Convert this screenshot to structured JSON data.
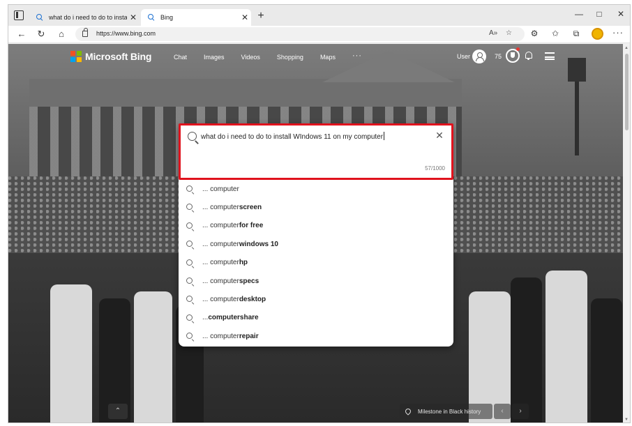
{
  "browser": {
    "tabs": [
      {
        "title": "what do i need to do to install W",
        "active": false
      },
      {
        "title": "Bing",
        "active": true
      }
    ],
    "new_tab": "+",
    "window_controls": {
      "minimize": "—",
      "maximize": "□",
      "close": "✕"
    },
    "url": "https://www.bing.com"
  },
  "bing": {
    "brand": "Microsoft Bing",
    "logo_colors": [
      "#f25022",
      "#7fba00",
      "#00a4ef",
      "#ffb900"
    ],
    "nav": [
      "Chat",
      "Images",
      "Videos",
      "Shopping",
      "Maps"
    ],
    "nav_more": "···",
    "user_label": "User",
    "points": "75"
  },
  "search": {
    "query": "what do i need to do to install WIndows 11 on my computer",
    "char_count": "57/1000",
    "highlight_color": "#e0121d",
    "suggestions": [
      {
        "prefix": "... computer",
        "bold": ""
      },
      {
        "prefix": "... computer ",
        "bold": "screen"
      },
      {
        "prefix": "... computer ",
        "bold": "for free"
      },
      {
        "prefix": "... computer ",
        "bold": "windows 10"
      },
      {
        "prefix": "... computer ",
        "bold": "hp"
      },
      {
        "prefix": "... computer ",
        "bold": "specs"
      },
      {
        "prefix": "... computer ",
        "bold": "desktop"
      },
      {
        "prefix": "... ",
        "bold": "computershare"
      },
      {
        "prefix": "... computer ",
        "bold": "repair"
      }
    ]
  },
  "footer": {
    "caption": "Milestone in Black history"
  }
}
